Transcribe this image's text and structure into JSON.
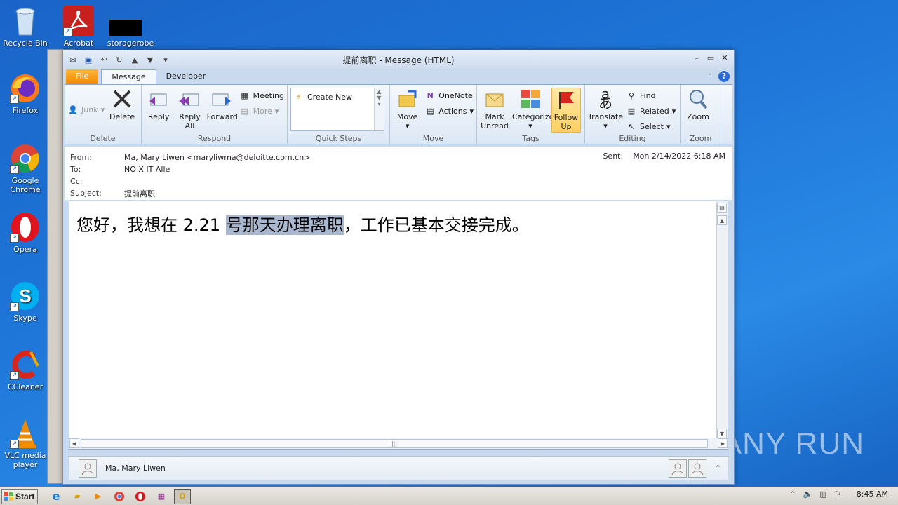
{
  "desktop": {
    "icons": [
      {
        "label": "Recycle Bin",
        "icon": "recycle-bin-icon"
      },
      {
        "label": "Acrobat",
        "icon": "acrobat-icon"
      },
      {
        "label": "storagerobe",
        "icon": "file-icon"
      },
      {
        "label": "Firefox",
        "icon": "firefox-icon"
      },
      {
        "label": "Google Chrome",
        "icon": "chrome-icon"
      },
      {
        "label": "Opera",
        "icon": "opera-icon"
      },
      {
        "label": "Skype",
        "icon": "skype-icon"
      },
      {
        "label": "CCleaner",
        "icon": "ccleaner-icon"
      },
      {
        "label": "VLC media player",
        "icon": "vlc-icon"
      }
    ],
    "watermark": "ANY RUN"
  },
  "window": {
    "title": "提前离职 - Message (HTML)",
    "tabs": {
      "file": "File",
      "message": "Message",
      "developer": "Developer"
    }
  },
  "ribbon": {
    "delete": {
      "label": "Delete",
      "junk": "Junk",
      "delete_btn": "Delete"
    },
    "respond": {
      "label": "Respond",
      "reply": "Reply",
      "reply_all": "Reply All",
      "forward": "Forward",
      "meeting": "Meeting",
      "more": "More"
    },
    "quick_steps": {
      "label": "Quick Steps",
      "create_new": "Create New"
    },
    "move": {
      "label": "Move",
      "move_btn": "Move",
      "onenote": "OneNote",
      "actions": "Actions"
    },
    "tags": {
      "label": "Tags",
      "mark_unread": "Mark Unread",
      "categorize": "Categorize",
      "follow_up": "Follow Up"
    },
    "editing": {
      "label": "Editing",
      "translate": "Translate",
      "find": "Find",
      "related": "Related",
      "select": "Select"
    },
    "zoom": {
      "label": "Zoom",
      "zoom_btn": "Zoom"
    }
  },
  "header": {
    "from_label": "From:",
    "from_value": "Ma, Mary Liwen <maryliwma@deloitte.com.cn>",
    "to_label": "To:",
    "to_value": "NO X IT Alle",
    "cc_label": "Cc:",
    "cc_value": "",
    "subject_label": "Subject:",
    "subject_value": "提前离职",
    "sent_label": "Sent:",
    "sent_value": "Mon 2/14/2022 6:18 AM"
  },
  "body": {
    "text_before": "您好，我想在 2.21 ",
    "text_highlight": "号那天办理离职",
    "text_after": "，工作已基本交接完成。"
  },
  "people_pane": {
    "name": "Ma, Mary Liwen"
  },
  "taskbar": {
    "start": "Start",
    "clock": "8:45 AM"
  }
}
